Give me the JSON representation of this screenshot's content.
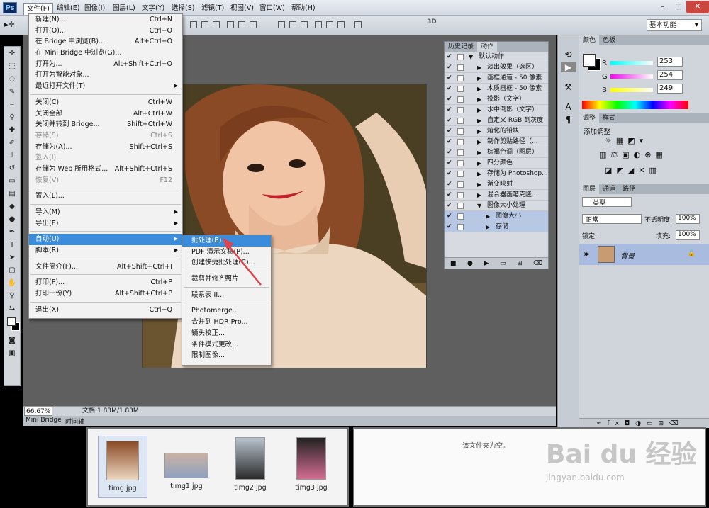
{
  "app": {
    "logo": "Ps"
  },
  "menubar": [
    "文件(F)",
    "编辑(E)",
    "图像(I)",
    "图层(L)",
    "文字(Y)",
    "选择(S)",
    "滤镜(T)",
    "视图(V)",
    "窗口(W)",
    "帮助(H)"
  ],
  "window": {
    "min": "–",
    "max": "□",
    "close": "✕"
  },
  "options": {
    "workspace": "基本功能"
  },
  "file_menu": [
    {
      "label": "新建(N)...",
      "shortcut": "Ctrl+N"
    },
    {
      "label": "打开(O)...",
      "shortcut": "Ctrl+O"
    },
    {
      "label": "在 Bridge 中浏览(B)...",
      "shortcut": "Alt+Ctrl+O"
    },
    {
      "label": "在 Mini Bridge 中浏览(G)...",
      "shortcut": ""
    },
    {
      "label": "打开为...",
      "shortcut": "Alt+Shift+Ctrl+O"
    },
    {
      "label": "打开为智能对象...",
      "shortcut": ""
    },
    {
      "label": "最近打开文件(T)",
      "shortcut": ""
    },
    {
      "label": "关闭(C)",
      "shortcut": "Ctrl+W"
    },
    {
      "label": "关闭全部",
      "shortcut": "Alt+Ctrl+W"
    },
    {
      "label": "关闭并转到 Bridge...",
      "shortcut": "Shift+Ctrl+W"
    },
    {
      "label": "存储(S)",
      "shortcut": "Ctrl+S"
    },
    {
      "label": "存储为(A)...",
      "shortcut": "Shift+Ctrl+S"
    },
    {
      "label": "签入(I)...",
      "shortcut": ""
    },
    {
      "label": "存储为 Web 所用格式...",
      "shortcut": "Alt+Shift+Ctrl+S"
    },
    {
      "label": "恢复(V)",
      "shortcut": "F12"
    },
    {
      "label": "置入(L)...",
      "shortcut": ""
    },
    {
      "label": "导入(M)",
      "shortcut": ""
    },
    {
      "label": "导出(E)",
      "shortcut": ""
    },
    {
      "label": "自动(U)",
      "shortcut": ""
    },
    {
      "label": "脚本(R)",
      "shortcut": ""
    },
    {
      "label": "文件简介(F)...",
      "shortcut": "Alt+Shift+Ctrl+I"
    },
    {
      "label": "打印(P)...",
      "shortcut": "Ctrl+P"
    },
    {
      "label": "打印一份(Y)",
      "shortcut": "Alt+Shift+Ctrl+P"
    },
    {
      "label": "退出(X)",
      "shortcut": "Ctrl+Q"
    }
  ],
  "auto_submenu": [
    "批处理(B)...",
    "PDF 演示文稿(P)...",
    "创建快捷批处理(C)...",
    "裁剪并修齐照片",
    "联系表 II...",
    "Photomerge...",
    "合并到 HDR Pro...",
    "镜头校正...",
    "条件模式更改...",
    "限制图像..."
  ],
  "actions_panel": {
    "tabs": [
      "历史记录",
      "动作"
    ],
    "rows": [
      "默认动作",
      "淡出效果（选区）",
      "画框通道 - 50 像素",
      "木质画框 - 50 像素",
      "投影（文字）",
      "水中倒影（文字）",
      "自定义 RGB 到灰度",
      "熔化的铅块",
      "制作剪贴路径（...",
      "棕褐色调（图层）",
      "四分颜色",
      "存储为 Photoshop...",
      "渐变映射",
      "混合器画笔克隆...",
      "图像大小处理",
      "图像大小",
      "存储"
    ]
  },
  "color_panel": {
    "tabs": [
      "颜色",
      "色板"
    ],
    "r_label": "R",
    "g_label": "G",
    "b_label": "B",
    "r": "253",
    "g": "254",
    "b": "249"
  },
  "adjust_panel": {
    "tabs": [
      "调整",
      "样式"
    ],
    "title": "添加调整"
  },
  "layers_panel": {
    "tabs": [
      "图层",
      "通道",
      "路径"
    ],
    "kind": "类型",
    "blend": "正常",
    "opacity_label": "不透明度:",
    "opacity": "100%",
    "lock_label": "锁定:",
    "fill_label": "填充:",
    "fill": "100%",
    "layer_name": "背景"
  },
  "status": {
    "zoom": "66.67%",
    "doc": "文档:1.83M/1.83M"
  },
  "bottom_tabs": [
    "Mini Bridge",
    "时间轴"
  ],
  "bridge": {
    "files": [
      "timg.jpg",
      "timg1.jpg",
      "timg2.jpg",
      "timg3.jpg"
    ],
    "empty_text": "该文件夹为空。"
  },
  "watermark": {
    "text": "Bai du 经验",
    "sub": "jingyan.baidu.com"
  },
  "colors": {
    "highlight": "#3c8cdc",
    "arrow": "#e0434a"
  }
}
